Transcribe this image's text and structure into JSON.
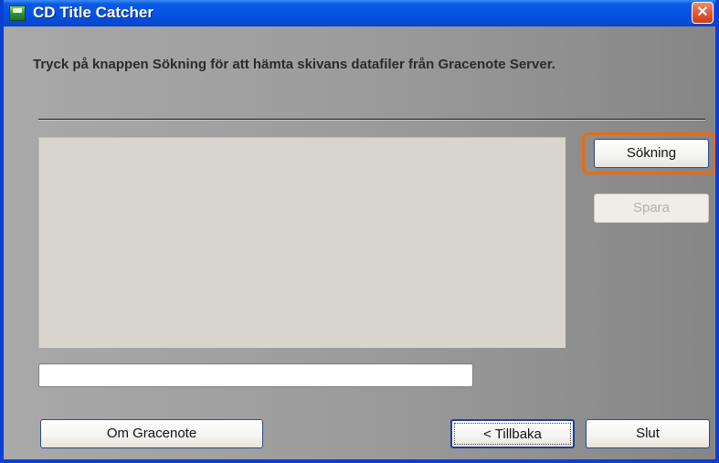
{
  "window": {
    "title": "CD Title Catcher",
    "close_label": "✕"
  },
  "instruction": "Tryck på knappen Sökning för att hämta skivans datafiler från Gracenote Server.",
  "buttons": {
    "search": "Sökning",
    "save": "Spara",
    "about": "Om Gracenote",
    "back": "< Tillbaka",
    "quit": "Slut"
  },
  "progress_field": {
    "value": ""
  },
  "colors": {
    "highlight": "#ec6a12",
    "titlebar": "#0551e0",
    "results_panel": "#d8d5ce"
  }
}
